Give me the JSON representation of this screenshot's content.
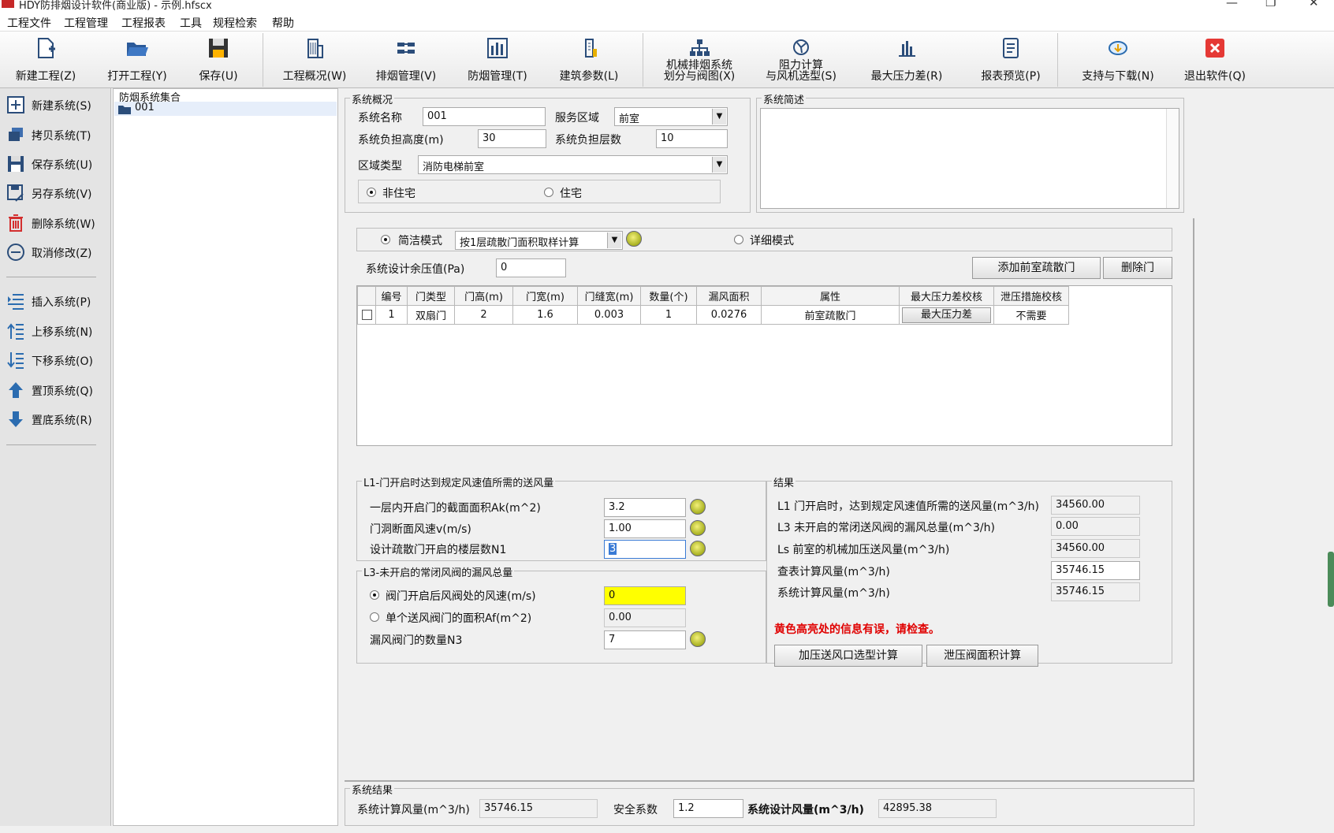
{
  "window": {
    "title": "HDY防排烟设计软件(商业版) - 示例.hfscx"
  },
  "menu": [
    "工程文件",
    "工程管理",
    "工程报表",
    "工具",
    "规程检索",
    "帮助"
  ],
  "toolbar": [
    {
      "label": "新建工程(Z)",
      "icon": "new-project-icon"
    },
    {
      "label": "打开工程(Y)",
      "icon": "folder-open-icon"
    },
    {
      "label": "保存(U)",
      "icon": "floppy-save-icon"
    },
    {
      "label": "工程概况(W)",
      "icon": "building-icon"
    },
    {
      "label": "排烟管理(V)",
      "icon": "smoke-exhaust-icon"
    },
    {
      "label": "防烟管理(T)",
      "icon": "smoke-prevent-icon"
    },
    {
      "label": "建筑参数(L)",
      "icon": "building-param-icon"
    },
    {
      "label1": "机械排烟系统",
      "label": "划分与阀图(X)",
      "icon": "org-chart-icon"
    },
    {
      "label1": "阻力计算",
      "label": "与风机选型(S)",
      "icon": "fan-calc-icon"
    },
    {
      "label": "最大压力差(R)",
      "icon": "pressure-chart-icon"
    },
    {
      "label": "报表预览(P)",
      "icon": "report-icon"
    },
    {
      "label": "支持与下载(N)",
      "icon": "download-cloud-icon"
    },
    {
      "label": "退出软件(Q)",
      "icon": "exit-icon"
    }
  ],
  "left_panel": [
    {
      "label": "新建系统(S)",
      "icon": "add-system-icon"
    },
    {
      "label": "拷贝系统(T)",
      "icon": "copy-system-icon"
    },
    {
      "label": "保存系统(U)",
      "icon": "save-system-icon"
    },
    {
      "label": "另存系统(V)",
      "icon": "save-as-icon"
    },
    {
      "label": "删除系统(W)",
      "icon": "trash-icon"
    },
    {
      "label": "取消修改(Z)",
      "icon": "cancel-icon"
    },
    {
      "label": "插入系统(P)",
      "icon": "insert-icon"
    },
    {
      "label": "上移系统(N)",
      "icon": "move-up-icon"
    },
    {
      "label": "下移系统(O)",
      "icon": "move-down-icon"
    },
    {
      "label": "置顶系统(Q)",
      "icon": "to-top-icon"
    },
    {
      "label": "置底系统(R)",
      "icon": "to-bottom-icon"
    }
  ],
  "tree": {
    "title": "防烟系统集合",
    "items": [
      "001"
    ]
  },
  "overview": {
    "group_title": "系统概况",
    "name_label": "系统名称",
    "name_value": "001",
    "area_label": "服务区域",
    "area_value": "前室",
    "height_label": "系统负担高度(m)",
    "height_value": "30",
    "floors_label": "系统负担层数",
    "floors_value": "10",
    "zone_label": "区域类型",
    "zone_value": "消防电梯前室",
    "non_residential": "非住宅",
    "residential": "住宅"
  },
  "description": {
    "group_title": "系统简述",
    "text": ""
  },
  "mode": {
    "simple_label": "简洁模式",
    "method_value": "按1层疏散门面积取样计算",
    "detail_label": "详细模式",
    "residual_label": "系统设计余压值(Pa)",
    "residual_value": "0",
    "add_door_button": "添加前室疏散门",
    "delete_door_button": "删除门"
  },
  "door_table": {
    "headers": [
      "编号",
      "门类型",
      "门高(m)",
      "门宽(m)",
      "门缝宽(m)",
      "数量(个)",
      "漏风面积",
      "属性",
      "最大压力差校核",
      "泄压措施校核"
    ],
    "rows": [
      [
        "1",
        "双扇门",
        "2",
        "1.6",
        "0.003",
        "1",
        "0.0276",
        "前室疏散门",
        "最大压力差",
        "不需要"
      ]
    ]
  },
  "l1": {
    "group_title": "L1-门开启时达到规定风速值所需的送风量",
    "ak_label": "一层内开启门的截面面积Ak(m^2)",
    "ak_value": "3.2",
    "v_label": "门洞断面风速v(m/s)",
    "v_value": "1.00",
    "n1_label": "设计疏散门开启的楼层数N1",
    "n1_value": "3"
  },
  "l3": {
    "group_title": "L3-未开启的常闭风阀的漏风总量",
    "speed_label": "阀门开启后风阀处的风速(m/s)",
    "speed_value": "0",
    "area_label": "单个送风阀门的面积Af(m^2)",
    "area_value": "0.00",
    "n3_label": "漏风阀门的数量N3",
    "n3_value": "7"
  },
  "result": {
    "group_title": "结果",
    "rows": [
      {
        "label": "L1 门开启时，达到规定风速值所需的送风量(m^3/h)",
        "value": "34560.00"
      },
      {
        "label": "L3 未开启的常闭送风阀的漏风总量(m^3/h)",
        "value": "0.00"
      },
      {
        "label": "Ls 前室的机械加压送风量(m^3/h)",
        "value": "34560.00"
      },
      {
        "label": "查表计算风量(m^3/h)",
        "value": "35746.15"
      },
      {
        "label": "系统计算风量(m^3/h)",
        "value": "35746.15"
      }
    ],
    "error": "黄色高亮处的信息有误，请检查。",
    "btn_outlet": "加压送风口选型计算",
    "btn_relief": "泄压阀面积计算"
  },
  "system_result": {
    "group_title": "系统结果",
    "calc_label": "系统计算风量(m^3/h)",
    "calc_value": "35746.15",
    "safety_label": "安全系数",
    "safety_value": "1.2",
    "design_label": "系统设计风量(m^3/h)",
    "design_value": "42895.38"
  },
  "colors": {
    "error": "#e00000",
    "highlight": "#ffff00",
    "exit": "#e53935"
  }
}
